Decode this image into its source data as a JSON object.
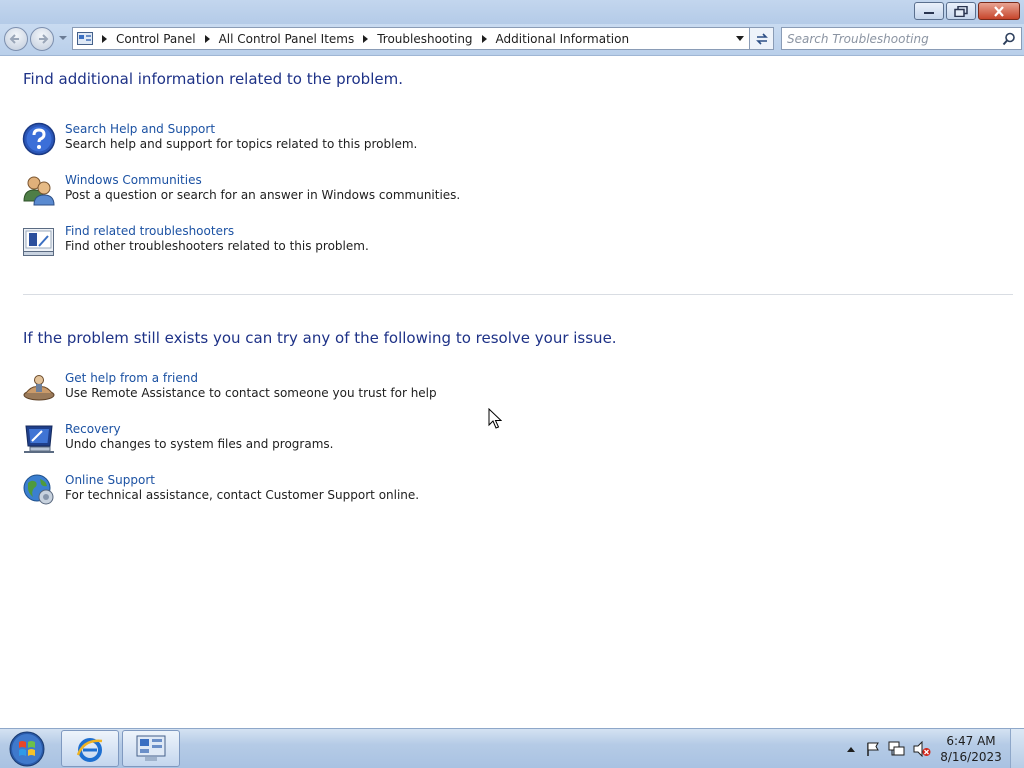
{
  "address_bar": {
    "breadcrumbs": [
      "Control Panel",
      "All Control Panel Items",
      "Troubleshooting",
      "Additional Information"
    ]
  },
  "search": {
    "placeholder": "Search Troubleshooting"
  },
  "section1": {
    "heading": "Find additional information related to the problem.",
    "items": [
      {
        "icon": "help-question-icon",
        "title": "Search Help and Support",
        "description": "Search help and support for topics related to this problem."
      },
      {
        "icon": "users-icon",
        "title": "Windows Communities",
        "description": "Post a question or search for an answer in Windows communities."
      },
      {
        "icon": "troubleshooter-icon",
        "title": "Find related troubleshooters",
        "description": "Find other troubleshooters related to this problem."
      }
    ]
  },
  "section2": {
    "heading": "If the problem still exists you can try any of the following to resolve your issue.",
    "items": [
      {
        "icon": "remote-assistance-icon",
        "title": "Get help from a friend",
        "description": "Use Remote Assistance to contact someone you trust for help"
      },
      {
        "icon": "recovery-icon",
        "title": "Recovery",
        "description": "Undo changes to system files and programs."
      },
      {
        "icon": "globe-icon",
        "title": "Online Support",
        "description": "For technical assistance, contact Customer Support online."
      }
    ]
  },
  "taskbar": {
    "apps": [
      "internet-explorer-icon",
      "control-panel-icon"
    ],
    "clock": {
      "time": "6:47 AM",
      "date": "8/16/2023"
    }
  }
}
